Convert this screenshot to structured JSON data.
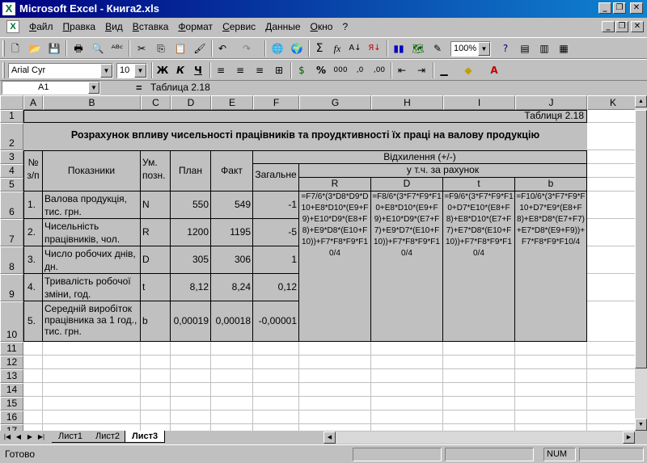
{
  "window": {
    "title": "Microsoft Excel - Книга2.xls",
    "app_icon": "excel-icon"
  },
  "menu": [
    "Файл",
    "Правка",
    "Вид",
    "Вставка",
    "Формат",
    "Сервис",
    "Данные",
    "Окно",
    "?"
  ],
  "toolbar": {
    "zoom": "100%",
    "font_name": "Arial Cyr",
    "font_size": "10",
    "bold": "Ж",
    "italic": "К",
    "underline": "Ч",
    "sum": "Σ",
    "fx": "fx",
    "percent": "%"
  },
  "formula_bar": {
    "name_box": "A1",
    "eq": "=",
    "formula": "Таблица 2.18"
  },
  "columns": [
    "A",
    "B",
    "C",
    "D",
    "E",
    "F",
    "G",
    "H",
    "I",
    "J",
    "K"
  ],
  "rows": [
    "1",
    "2",
    "3",
    "4",
    "5",
    "6",
    "7",
    "8",
    "9",
    "10",
    "11",
    "12",
    "13",
    "14",
    "15",
    "16",
    "17"
  ],
  "sheet": {
    "table_label": "Таблиця 2.18",
    "title": "Розрахунок впливу чисельності працівників та проудктивності їх праці на валову продукцію",
    "headers": {
      "num": "№ з/п",
      "indicators": "Показники",
      "unit": "Ум. позн.",
      "plan": "План",
      "fact": "Факт",
      "deviation": "Відхилення (+/-)",
      "total": "Загальне",
      "by_factors": "у т.ч. за рахунок",
      "factors": [
        "R",
        "D",
        "t",
        "b"
      ]
    },
    "data_rows": [
      {
        "num": "1.",
        "name": "Валова продукція, тис. грн.",
        "unit": "N",
        "plan": "550",
        "fact": "549",
        "total": "-1"
      },
      {
        "num": "2.",
        "name": "Чисельність працівників, чол.",
        "unit": "R",
        "plan": "1200",
        "fact": "1195",
        "total": "-5"
      },
      {
        "num": "3.",
        "name": "Число робочих днів, дн.",
        "unit": "D",
        "plan": "305",
        "fact": "306",
        "total": "1"
      },
      {
        "num": "4.",
        "name": "Тривалість робочої зміни, год.",
        "unit": "t",
        "plan": "8,12",
        "fact": "8,24",
        "total": "0,12"
      },
      {
        "num": "5.",
        "name": "Середній виробіток працівника за 1 год., тис. грн.",
        "unit": "b",
        "plan": "0,00019",
        "fact": "0,00018",
        "total": "-0,00001"
      }
    ],
    "formulas": {
      "R": "=F7/6*(3*D8*D9*D10+E8*D10*(E9+F9)+E10*D9*(E8+F8)+E9*D8*(E10+F10))+F7*F8*F9*F10/4",
      "D": "=F8/6*(3*F7*F9*F10+E8*D10*(E9+F9)+E10*D9*(E7+F7)+E9*D7*(E10+F10))+F7*F8*F9*F10/4",
      "t": "=F9/6*(3*F7*F9*F10+D7*E10*(E8+F8)+E8*D10*(E7+F7)+E7*D8*(E10+F10))+F7*F8*F9*F10/4",
      "b": "=F10/6*(3*F7*F9*F10+D7*E9*(E8+F8)+E8*D8*(E7+F7)+E7*D8*(E9+F9))+F7*F8*F9*F10/4"
    }
  },
  "tabs": [
    "Лист1",
    "Лист2",
    "Лист3"
  ],
  "active_tab": "Лист3",
  "status": {
    "ready": "Готово",
    "num": "NUM"
  }
}
